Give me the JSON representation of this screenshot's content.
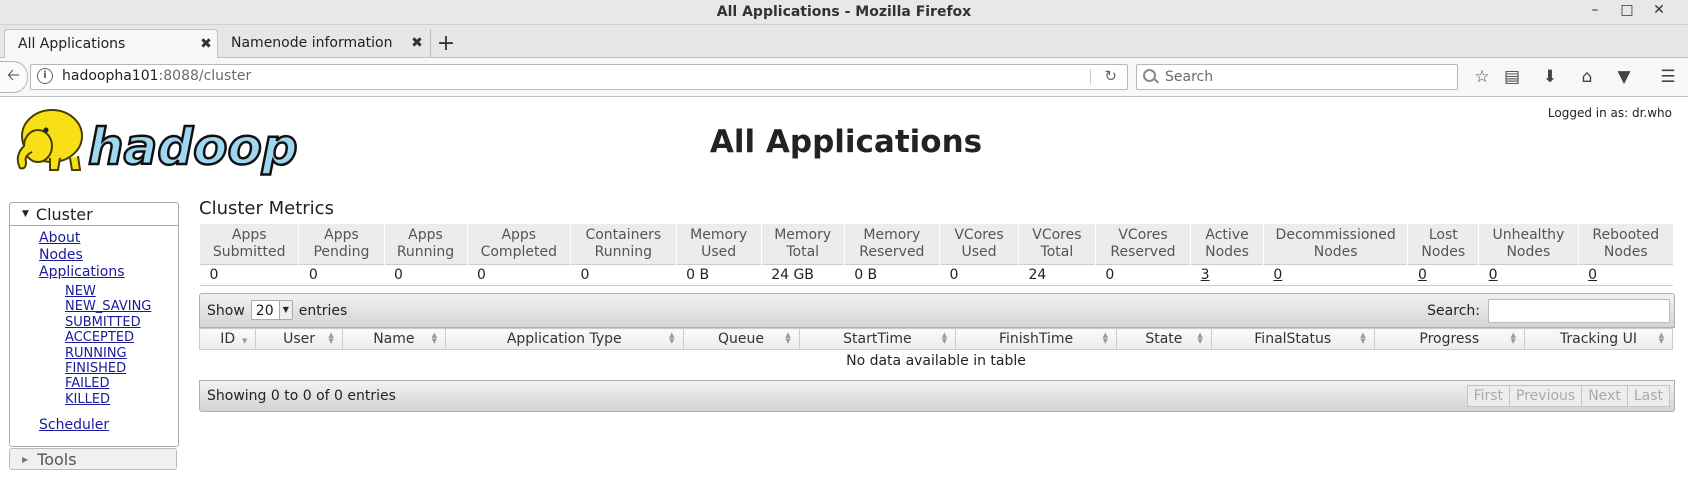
{
  "window": {
    "title": "All Applications - Mozilla Firefox",
    "controls": [
      "minimize-icon",
      "maximize-icon",
      "close-icon"
    ]
  },
  "tabs": [
    {
      "label": "All Applications",
      "active": true
    },
    {
      "label": "Namenode information",
      "active": false
    }
  ],
  "nav": {
    "url_host": "hadoopha101",
    "url_path": ":8088/cluster",
    "search_placeholder": "Search"
  },
  "page": {
    "title": "All Applications",
    "logged_in": "Logged in as: dr.who",
    "logo_text": "hadoop"
  },
  "sidebar": {
    "cluster_label": "Cluster",
    "links": [
      "About",
      "Nodes",
      "Applications"
    ],
    "app_states": [
      "NEW",
      "NEW_SAVING",
      "SUBMITTED",
      "ACCEPTED",
      "RUNNING",
      "FINISHED",
      "FAILED",
      "KILLED"
    ],
    "scheduler": "Scheduler",
    "tools_label": "Tools"
  },
  "metrics": {
    "title": "Cluster Metrics",
    "headers": [
      [
        "Apps",
        "Submitted"
      ],
      [
        "Apps",
        "Pending"
      ],
      [
        "Apps",
        "Running"
      ],
      [
        "Apps",
        "Completed"
      ],
      [
        "Containers",
        "Running"
      ],
      [
        "Memory",
        "Used"
      ],
      [
        "Memory",
        "Total"
      ],
      [
        "Memory",
        "Reserved"
      ],
      [
        "VCores",
        "Used"
      ],
      [
        "VCores",
        "Total"
      ],
      [
        "VCores",
        "Reserved"
      ],
      [
        "Active",
        "Nodes"
      ],
      [
        "Decommissioned",
        "Nodes"
      ],
      [
        "Lost",
        "Nodes"
      ],
      [
        "Unhealthy",
        "Nodes"
      ],
      [
        "Rebooted",
        "Nodes"
      ]
    ],
    "values": [
      "0",
      "0",
      "0",
      "0",
      "0",
      "0 B",
      "24 GB",
      "0 B",
      "0",
      "24",
      "0",
      "3",
      "0",
      "0",
      "0",
      "0"
    ]
  },
  "apps_table": {
    "show_label": "Show",
    "page_size": "20",
    "entries_label": "entries",
    "search_label": "Search:",
    "columns": [
      "ID",
      "User",
      "Name",
      "Application Type",
      "Queue",
      "StartTime",
      "FinishTime",
      "State",
      "FinalStatus",
      "Progress",
      "Tracking UI"
    ],
    "empty_message": "No data available in table",
    "info": "Showing 0 to 0 of 0 entries",
    "pager": [
      "First",
      "Previous",
      "Next",
      "Last"
    ]
  }
}
